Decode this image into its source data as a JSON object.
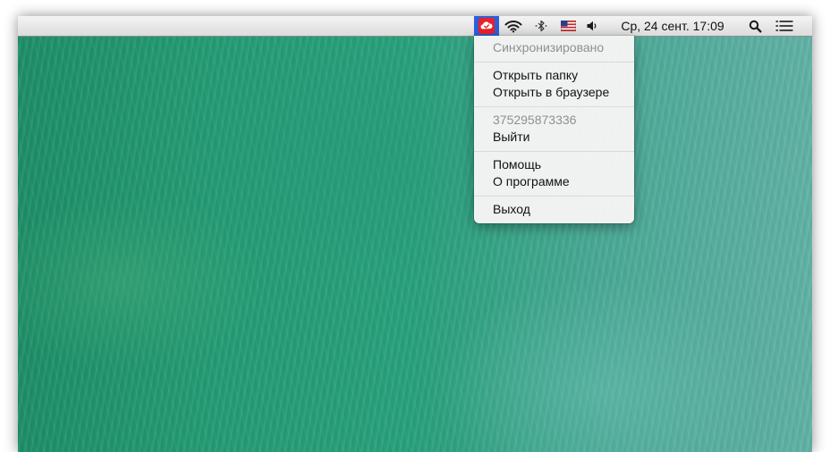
{
  "menubar": {
    "clock": "Ср, 24 сент.  17:09",
    "icons": {
      "app": "cloud-check-icon",
      "wifi": "wifi-icon",
      "bluetooth": "bluetooth-icon",
      "input_source": "us-flag-icon",
      "volume": "volume-icon",
      "spotlight": "search-icon",
      "notifications": "list-icon"
    },
    "app_icon_color": "#e8212b",
    "highlight_color": "#2f5fd6"
  },
  "menu": {
    "status": "Синхронизировано",
    "open_folder": "Открыть папку",
    "open_browser": "Открыть в браузере",
    "account": "375295873336",
    "logout": "Выйти",
    "help": "Помощь",
    "about": "О программе",
    "quit": "Выход"
  }
}
